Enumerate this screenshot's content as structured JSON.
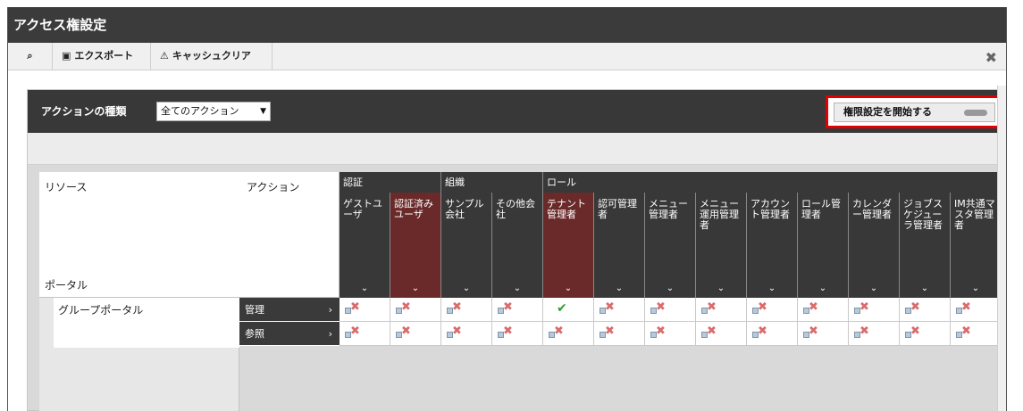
{
  "window": {
    "title": "アクセス権設定"
  },
  "toolbar": {
    "search_icon": "search-icon",
    "export_label": "エクスポート",
    "cache_clear_label": "キャッシュクリア",
    "close_icon": "close-icon"
  },
  "panel": {
    "action_type_label": "アクションの種類",
    "action_type_value": "全てのアクション",
    "start_button_label": "権限設定を開始する"
  },
  "grid": {
    "resource_header": "リソース",
    "action_header": "アクション",
    "portal_label": "ポータル",
    "resource_name": "グループポータル",
    "actions": [
      "管理",
      "参照"
    ],
    "groups": [
      {
        "label": "認証"
      },
      {
        "label": "組織"
      },
      {
        "label": "ロール"
      }
    ],
    "roles": [
      {
        "label": "ゲストユーザ"
      },
      {
        "label": "認証済みユーザ"
      },
      {
        "label": "サンプル会社"
      },
      {
        "label": "その他会社"
      },
      {
        "label": "テナント管理者"
      },
      {
        "label": "認可管理者"
      },
      {
        "label": "メニュー管理者"
      },
      {
        "label": "メニュー運用管理者"
      },
      {
        "label": "アカウント管理者"
      },
      {
        "label": "ロール管理者"
      },
      {
        "label": "カレンダー管理者"
      },
      {
        "label": "ジョブスケジューラ管理者"
      },
      {
        "label": "IM共通マスタ管理者"
      }
    ]
  }
}
